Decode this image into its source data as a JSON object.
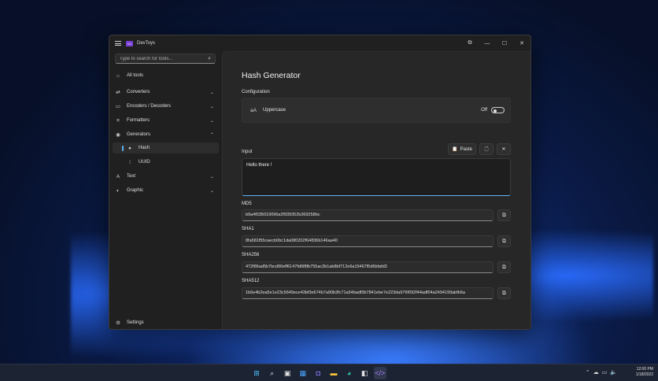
{
  "app": {
    "title": "DevToys",
    "logo_text": "</>"
  },
  "window_controls": {
    "compact": "⧉",
    "minimize": "—",
    "maximize": "☐",
    "close": "✕"
  },
  "sidebar": {
    "search_placeholder": "Type to search for tools...",
    "items": [
      {
        "label": "All tools",
        "icon": "home-icon"
      },
      {
        "label": "Converters",
        "icon": "converter-icon"
      },
      {
        "label": "Encoders / Decoders",
        "icon": "encoder-icon"
      },
      {
        "label": "Formatters",
        "icon": "formatter-icon"
      },
      {
        "label": "Generators",
        "icon": "generator-icon"
      },
      {
        "label": "Hash",
        "icon": "hash-icon",
        "selected": true
      },
      {
        "label": "UUID",
        "icon": "uuid-icon"
      },
      {
        "label": "Text",
        "icon": "text-icon"
      },
      {
        "label": "Graphic",
        "icon": "graphic-icon"
      }
    ],
    "settings_label": "Settings"
  },
  "main": {
    "title": "Hash Generator",
    "configuration_label": "Configuration",
    "uppercase": {
      "icon_text": "aA",
      "label": "Uppercase",
      "state": "Off"
    },
    "input_label": "Input",
    "paste_label": "Paste",
    "input_value": "Hello there !",
    "hashes": [
      {
        "label": "MD5",
        "value": "b9a4f035019096a2f939352b369258bc"
      },
      {
        "label": "SHA1",
        "value": "8fa581f55caecb0bc1da080202f64836b146aa40"
      },
      {
        "label": "SHA256",
        "value": "472f86ad5b7bcd90eff6147fd6f8fb755ac3b1ab8bf712e6a19467f5d6bfafd3"
      },
      {
        "label": "SHA512",
        "value": "1b5e4b2ea5e1e23c5649ece43bf3e674b7a90b3fc71a54badf3b7841ebe7e223da976f092f44adf04a2494199abfb6a"
      }
    ]
  },
  "taskbar": {
    "time": "12:00 PM",
    "date": "1/18/2022",
    "icons": [
      "windows-start-icon",
      "search-icon",
      "task-view-icon",
      "widgets-icon",
      "chat-icon",
      "file-explorer-icon",
      "edge-icon",
      "store-icon",
      "devtoys-icon"
    ]
  },
  "colors": {
    "accent": "#5fb2f2",
    "window_bg": "#202020",
    "content_bg": "#272727",
    "app_logo": "#7a3fd6"
  }
}
